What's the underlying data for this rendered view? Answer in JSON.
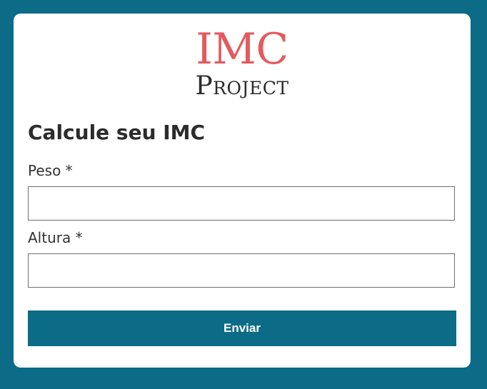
{
  "logo": {
    "main_text": "IMC",
    "sub_text": "Project"
  },
  "form": {
    "title": "Calcule seu IMC",
    "peso": {
      "label": "Peso *",
      "value": "",
      "placeholder": ""
    },
    "altura": {
      "label": "Altura *",
      "value": "",
      "placeholder": ""
    },
    "submit_label": "Enviar"
  },
  "colors": {
    "background": "#0c6b87",
    "card": "#ffffff",
    "logo_accent": "#e35a5f",
    "button": "#0c6b87"
  }
}
